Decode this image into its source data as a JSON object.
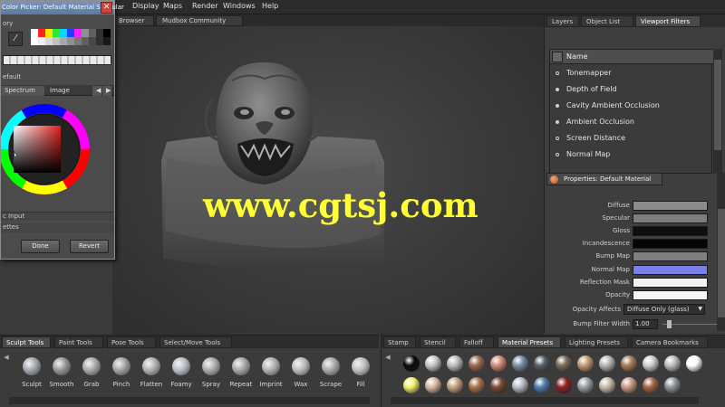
{
  "menubar": {
    "items": [
      "Display",
      "Maps",
      "Render",
      "Windows",
      "Help"
    ]
  },
  "doc_tabs": [
    "Browser",
    "Mudbox Community"
  ],
  "viewport": {
    "watermark": "www.cgtsj.com"
  },
  "color_picker": {
    "title": "Color Picker: Default Material Specular",
    "history_label": "ory",
    "section_label": "efault",
    "tabs": [
      "Spectrum",
      "Image"
    ],
    "input_label": "c Input",
    "palettes_label": "ettes",
    "done_label": "Done",
    "revert_label": "Revert",
    "swatches": [
      "#ffffff",
      "#ff2020",
      "#ffe400",
      "#2ee82e",
      "#00d8ff",
      "#2040ff",
      "#ff20ff",
      "#909090",
      "#606060",
      "#303030",
      "#000000",
      "#ffffff",
      "#f0f0f0",
      "#d8d8d8",
      "#c0c0c0",
      "#a8a8a8",
      "#909090",
      "#787878",
      "#606060",
      "#484848",
      "#303030",
      "#181818"
    ]
  },
  "right_panel": {
    "tabs": [
      "Layers",
      "Object List",
      "Viewport Filters"
    ],
    "filter_header": "Name",
    "filters": [
      {
        "label": "Tonemapper",
        "on": false
      },
      {
        "label": "Depth of Field",
        "on": true
      },
      {
        "label": "Cavity Ambient Occlusion",
        "on": true
      },
      {
        "label": "Ambient Occlusion",
        "on": true
      },
      {
        "label": "Screen Distance",
        "on": false
      },
      {
        "label": "Normal Map",
        "on": false
      }
    ],
    "properties_title": "Properties: Default Material",
    "properties": [
      {
        "label": "Diffuse",
        "color": "#8c8c8c"
      },
      {
        "label": "Specular",
        "color": "#7d7d7d"
      },
      {
        "label": "Gloss",
        "color": "#0e0e0e"
      },
      {
        "label": "Incandescence",
        "color": "#050505"
      },
      {
        "label": "Bump Map",
        "color": "#7f7f7f"
      },
      {
        "label": "Normal Map",
        "color": "#7b7fe8"
      },
      {
        "label": "Reflection Mask",
        "color": "#f2f2f2"
      },
      {
        "label": "Opacity",
        "color": "#f5f5f5"
      }
    ],
    "opacity_affects_label": "Opacity Affects",
    "opacity_affects_value": "Diffuse Only (glass)",
    "bump_width_label": "Bump Filter Width",
    "bump_width_value": "1.00"
  },
  "sculpt_shelf": {
    "tabs": [
      "Sculpt Tools",
      "Paint Tools",
      "Pose Tools",
      "Select/Move Tools"
    ],
    "tools": [
      "Sculpt",
      "Smooth",
      "Grab",
      "Pinch",
      "Flatten",
      "Foamy",
      "Spray",
      "Repeat",
      "Imprint",
      "Wax",
      "Scrape",
      "Fill"
    ]
  },
  "material_shelf": {
    "tabs": [
      "Stamp",
      "Stencil",
      "Falloff",
      "Material Presets",
      "Lighting Presets",
      "Camera Bookmarks"
    ],
    "row1": [
      "#0a0a0a",
      "#c8c8c8",
      "#bdbdbd",
      "#9c6a52",
      "#d38b78",
      "#7a8ea8",
      "#556066",
      "#7a6a58",
      "#c49a74",
      "#b7b7b7",
      "#a67b5b",
      "#cdd0d3",
      "#bdbdbd",
      "#ffffff"
    ],
    "row2": [
      "#f2ef6a",
      "#d9b8a0",
      "#c4a381",
      "#a8734f",
      "#7b4a34",
      "#b8bec5",
      "#4f7fae",
      "#8e2222",
      "#9aa0a6",
      "#c7bba6",
      "#c89b84",
      "#a26546",
      "#8f939a"
    ]
  }
}
